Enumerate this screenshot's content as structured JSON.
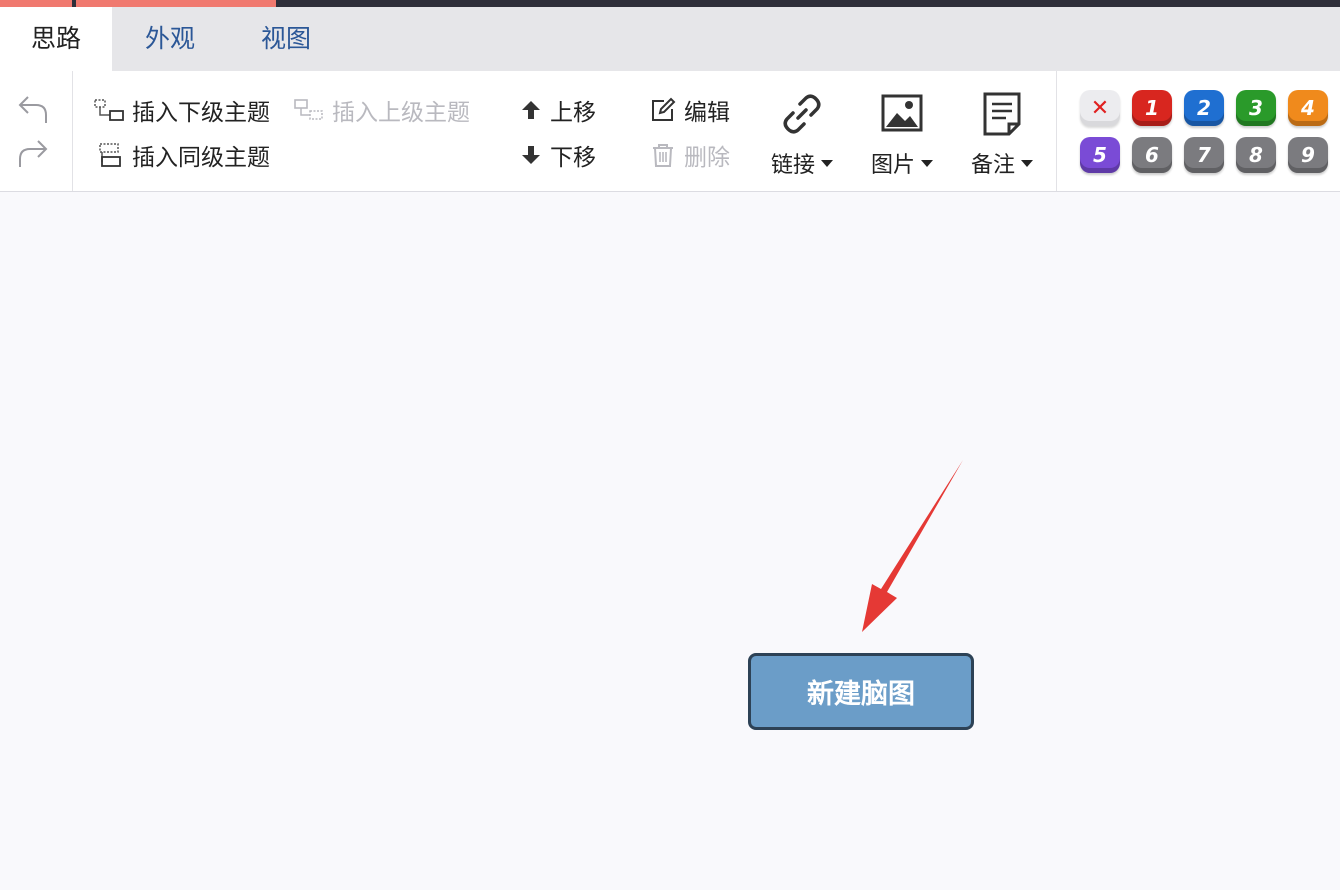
{
  "tabs": [
    {
      "label": "思路",
      "active": true
    },
    {
      "label": "外观",
      "active": false
    },
    {
      "label": "视图",
      "active": false
    }
  ],
  "toolbar": {
    "undo_icon": "undo-icon",
    "redo_icon": "redo-icon",
    "insert_child_label": "插入下级主题",
    "insert_parent_label": "插入上级主题",
    "insert_sibling_label": "插入同级主题",
    "move_up_label": "上移",
    "move_down_label": "下移",
    "edit_label": "编辑",
    "delete_label": "删除",
    "link_label": "链接",
    "image_label": "图片",
    "note_label": "备注"
  },
  "priorities": {
    "clear_symbol": "✕",
    "items": [
      {
        "label": "1",
        "color": "#d8261f"
      },
      {
        "label": "2",
        "color": "#1f6fd1"
      },
      {
        "label": "3",
        "color": "#2a9a2a"
      },
      {
        "label": "4",
        "color": "#f08a1c"
      },
      {
        "label": "5",
        "color": "#7a4bd6"
      },
      {
        "label": "6",
        "color": "#7b7b7f"
      },
      {
        "label": "7",
        "color": "#7b7b7f"
      },
      {
        "label": "8",
        "color": "#7b7b7f"
      },
      {
        "label": "9",
        "color": "#7b7b7f"
      }
    ]
  },
  "canvas": {
    "root_node_label": "新建脑图",
    "annotation_color": "#e53935"
  }
}
